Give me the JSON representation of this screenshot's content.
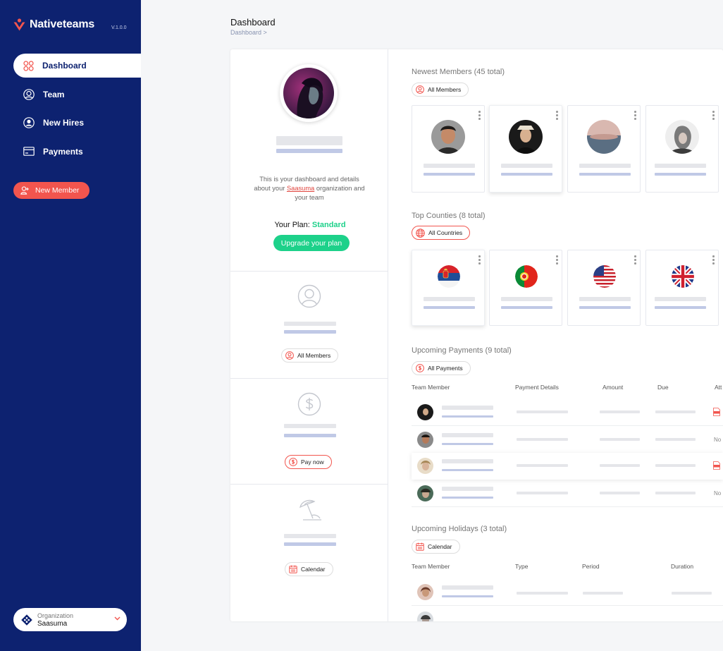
{
  "app": {
    "brand": "Nativeteams",
    "version": "V.1.0.0"
  },
  "sidebar": {
    "items": [
      {
        "label": "Dashboard",
        "icon": "grid-icon",
        "active": true
      },
      {
        "label": "Team",
        "icon": "user-circle-icon"
      },
      {
        "label": "New Hires",
        "icon": "user-badge-icon"
      },
      {
        "label": "Payments",
        "icon": "card-icon"
      }
    ],
    "new_member": "New Member",
    "org": {
      "label": "Organization",
      "value": "Saasuma"
    }
  },
  "header": {
    "title": "Dashboard",
    "breadcrumb": "Dashboard >"
  },
  "profile": {
    "intro_before": "This is your dashboard and details about your ",
    "intro_org": "Saasuma",
    "intro_after": " organization and your team",
    "plan_label": "Your Plan: ",
    "plan_value": "Standard",
    "upgrade": "Upgrade your plan"
  },
  "left_sections": [
    {
      "icon": "team-icon",
      "button": "All Members"
    },
    {
      "icon": "dollar-icon",
      "button": "Pay now"
    },
    {
      "icon": "beach-umbrella-icon",
      "button": "Calendar"
    }
  ],
  "newest_members": {
    "title": "Newest Members (45 total)",
    "button": "All Members"
  },
  "top_countries": {
    "title": "Top Counties (8 total)",
    "button": "All Countries",
    "flags": [
      "serbia-flag",
      "portugal-flag",
      "usa-flag",
      "uk-flag"
    ]
  },
  "upcoming_payments": {
    "title": "Upcoming Payments (9 total)",
    "button": "All Payments",
    "columns": [
      "Team Member",
      "Payment Details",
      "Amount",
      "Due",
      "Att"
    ],
    "rows": [
      {
        "attachment": "pdf"
      },
      {
        "attachment": "No"
      },
      {
        "attachment": "pdf"
      },
      {
        "attachment": "No"
      }
    ]
  },
  "upcoming_holidays": {
    "title": "Upcoming Holidays (3 total)",
    "button": "Calendar",
    "columns": [
      "Team Member",
      "Type",
      "Period",
      "Duration"
    ]
  },
  "colors": {
    "navy": "#0d2270",
    "accent_red": "#f2554e",
    "accent_green": "#1dd18a"
  }
}
